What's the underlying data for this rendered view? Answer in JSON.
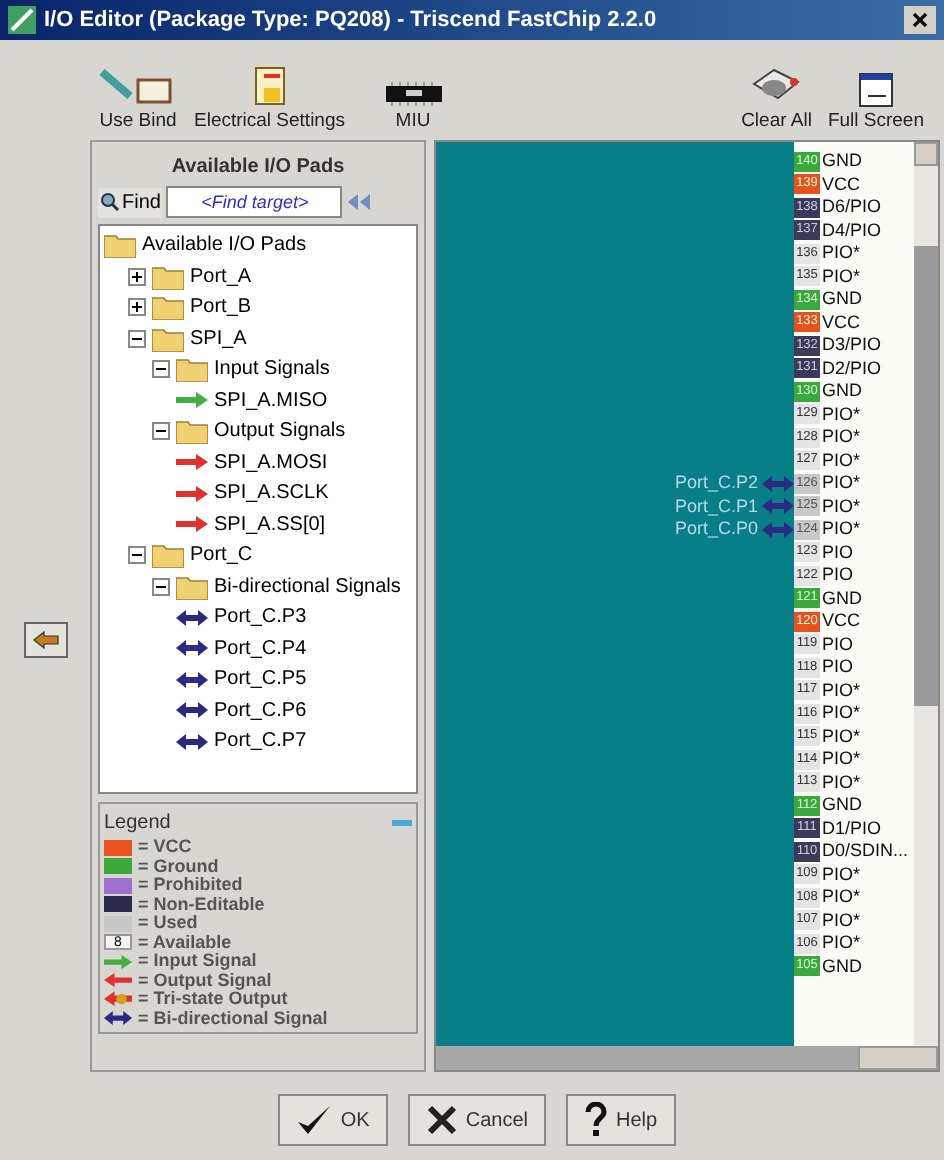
{
  "window": {
    "title": "I/O Editor (Package Type: PQ208) - Triscend FastChip 2.2.0"
  },
  "toolbar": [
    {
      "label": "Use Bind",
      "kind": "bind"
    },
    {
      "label": "Electrical Settings",
      "kind": "settings"
    },
    {
      "label": "MIU",
      "kind": "chip"
    },
    {
      "label": "Clear All",
      "kind": "clear"
    },
    {
      "label": "Full Screen",
      "kind": "screen"
    }
  ],
  "panel": {
    "title": "Available I/O Pads",
    "find_button": "Find",
    "find_placeholder": "<Find target>"
  },
  "tree": [
    {
      "label": "Available I/O Pads",
      "children": [
        {
          "label": "Port_A",
          "expanded": false
        },
        {
          "label": "Port_B",
          "expanded": false
        },
        {
          "label": "SPI_A",
          "expanded": true,
          "children": [
            {
              "label": "Input Signals",
              "expanded": true,
              "children": [
                {
                  "label": "SPI_A.MISO",
                  "kind": "input"
                }
              ]
            },
            {
              "label": "Output Signals",
              "expanded": true,
              "children": [
                {
                  "label": "SPI_A.MOSI",
                  "kind": "output"
                },
                {
                  "label": "SPI_A.SCLK",
                  "kind": "output"
                },
                {
                  "label": "SPI_A.SS[0]",
                  "kind": "output"
                }
              ]
            }
          ]
        },
        {
          "label": "Port_C",
          "expanded": true,
          "children": [
            {
              "label": "Bi-directional Signals",
              "expanded": true,
              "children": [
                {
                  "label": "Port_C.P3",
                  "kind": "bidir"
                },
                {
                  "label": "Port_C.P4",
                  "kind": "bidir"
                },
                {
                  "label": "Port_C.P5",
                  "kind": "bidir"
                },
                {
                  "label": "Port_C.P6",
                  "kind": "bidir"
                },
                {
                  "label": "Port_C.P7",
                  "kind": "bidir"
                }
              ]
            }
          ]
        }
      ]
    }
  ],
  "legend": {
    "title": "Legend",
    "items": [
      {
        "kind": "vcc",
        "label": "= VCC"
      },
      {
        "kind": "gnd",
        "label": "= Ground"
      },
      {
        "kind": "prohibited",
        "label": "= Prohibited"
      },
      {
        "kind": "noneditable",
        "label": "= Non-Editable"
      },
      {
        "kind": "used",
        "label": "= Used"
      },
      {
        "kind": "available",
        "label": "= Available",
        "swatch": "8"
      },
      {
        "kind": "input",
        "label": "= Input Signal"
      },
      {
        "kind": "output",
        "label": "= Output Signal"
      },
      {
        "kind": "tristate",
        "label": "= Tri-state Output"
      },
      {
        "kind": "bidir",
        "label": "= Bi-directional Signal"
      }
    ]
  },
  "pins": [
    {
      "number": "140",
      "name": "GND",
      "kind": "gnd"
    },
    {
      "number": "139",
      "name": "VCC",
      "kind": "vcc"
    },
    {
      "number": "138",
      "name": "D6/PIO",
      "kind": "noneditable"
    },
    {
      "number": "137",
      "name": "D4/PIO",
      "kind": "noneditable"
    },
    {
      "number": "136",
      "name": "PIO*",
      "kind": "available"
    },
    {
      "number": "135",
      "name": "PIO*",
      "kind": "available"
    },
    {
      "number": "134",
      "name": "GND",
      "kind": "gnd"
    },
    {
      "number": "133",
      "name": "VCC",
      "kind": "vcc"
    },
    {
      "number": "132",
      "name": "D3/PIO",
      "kind": "noneditable"
    },
    {
      "number": "131",
      "name": "D2/PIO",
      "kind": "noneditable"
    },
    {
      "number": "130",
      "name": "GND",
      "kind": "gnd"
    },
    {
      "number": "129",
      "name": "PIO*",
      "kind": "available"
    },
    {
      "number": "128",
      "name": "PIO*",
      "kind": "available"
    },
    {
      "number": "127",
      "name": "PIO*",
      "kind": "available"
    },
    {
      "number": "126",
      "name": "PIO*",
      "kind": "used",
      "signal": "Port_C.P2"
    },
    {
      "number": "125",
      "name": "PIO*",
      "kind": "used",
      "signal": "Port_C.P1"
    },
    {
      "number": "124",
      "name": "PIO*",
      "kind": "used",
      "signal": "Port_C.P0"
    },
    {
      "number": "123",
      "name": "PIO",
      "kind": "available"
    },
    {
      "number": "122",
      "name": "PIO",
      "kind": "available"
    },
    {
      "number": "121",
      "name": "GND",
      "kind": "gnd"
    },
    {
      "number": "120",
      "name": "VCC",
      "kind": "vcc"
    },
    {
      "number": "119",
      "name": "PIO",
      "kind": "available"
    },
    {
      "number": "118",
      "name": "PIO",
      "kind": "available"
    },
    {
      "number": "117",
      "name": "PIO*",
      "kind": "available"
    },
    {
      "number": "116",
      "name": "PIO*",
      "kind": "available"
    },
    {
      "number": "115",
      "name": "PIO*",
      "kind": "available"
    },
    {
      "number": "114",
      "name": "PIO*",
      "kind": "available"
    },
    {
      "number": "113",
      "name": "PIO*",
      "kind": "available"
    },
    {
      "number": "112",
      "name": "GND",
      "kind": "gnd"
    },
    {
      "number": "111",
      "name": "D1/PIO",
      "kind": "noneditable"
    },
    {
      "number": "110",
      "name": "D0/SDIN...",
      "kind": "noneditable"
    },
    {
      "number": "109",
      "name": "PIO*",
      "kind": "available"
    },
    {
      "number": "108",
      "name": "PIO*",
      "kind": "available"
    },
    {
      "number": "107",
      "name": "PIO*",
      "kind": "available"
    },
    {
      "number": "106",
      "name": "PIO*",
      "kind": "available"
    },
    {
      "number": "105",
      "name": "GND",
      "kind": "gnd"
    }
  ],
  "buttons": [
    {
      "label": "OK",
      "kind": "ok"
    },
    {
      "label": "Cancel",
      "kind": "cancel"
    },
    {
      "label": "Help",
      "kind": "help"
    }
  ]
}
